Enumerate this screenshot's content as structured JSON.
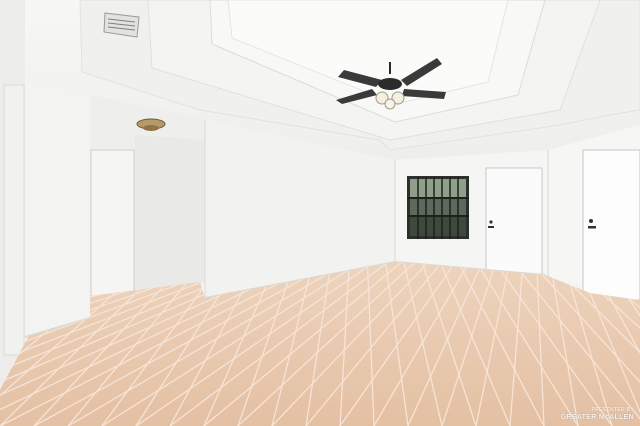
{
  "scene": {
    "caption": "",
    "watermark": {
      "line1": "PRESENTED BY",
      "line2": "GREATER McALLEN"
    },
    "colors": {
      "wall": "#f4f4f2",
      "ceiling": "#f6f6f4",
      "floor": "#e8c8ad",
      "grout": "#f2dccb",
      "door": "#fbfbfb"
    }
  }
}
